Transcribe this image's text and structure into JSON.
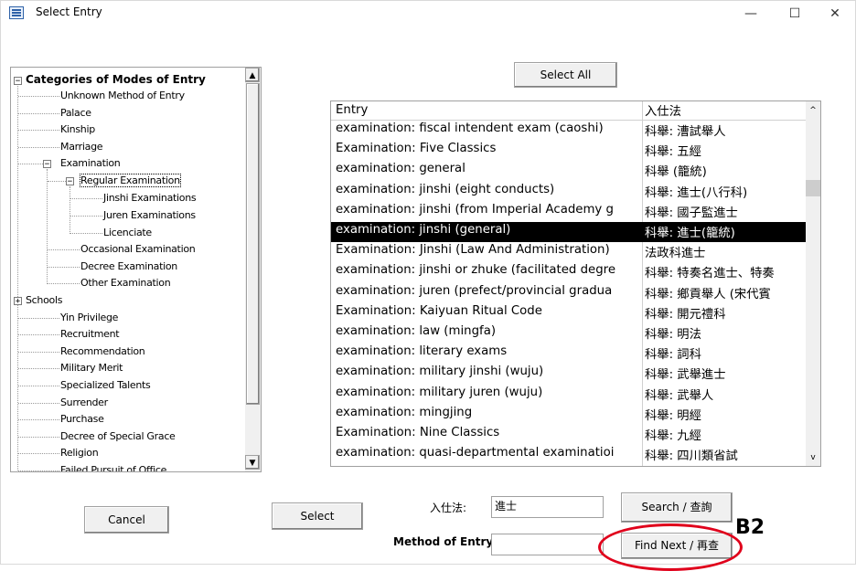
{
  "window": {
    "title": "Select Entry",
    "controls": {
      "minimize": "—",
      "maximize": "☐",
      "close": "✕"
    }
  },
  "tree": {
    "root": "Categories of Modes of Entry",
    "items": [
      "Unknown Method of Entry",
      "Palace",
      "Kinship",
      "Marriage",
      "Examination",
      "Regular Examination",
      "Jinshi Examinations",
      "Juren Examinations",
      "Licenciate",
      "Occasional Examination",
      "Decree Examination",
      "Other Examination",
      "Schools",
      "Yin Privilege",
      "Recruitment",
      "Recommendation",
      "Military Merit",
      "Specialized Talents",
      "Surrender",
      "Purchase",
      "Decree of Special Grace",
      "Religion",
      "Failed Pursuit of Office"
    ],
    "scroll_position": 0.0
  },
  "buttons": {
    "select_all": "Select All",
    "cancel": "Cancel",
    "select": "Select",
    "search": "Search / 查詢",
    "find_next": "Find Next / 再查"
  },
  "list": {
    "headers": [
      "Entry",
      "入仕法"
    ],
    "rows": [
      [
        "examination: fiscal intendent exam (caoshi)",
        "科舉: 漕試舉人"
      ],
      [
        "Examination: Five Classics",
        "科舉: 五經"
      ],
      [
        "examination: general",
        "科舉 (籠統)"
      ],
      [
        "examination: jinshi (eight conducts)",
        "科舉: 進士(八行科)"
      ],
      [
        "examination: jinshi (from Imperial Academy g",
        "科舉: 國子監進士"
      ],
      [
        "examination: jinshi (general)",
        "科舉: 進士(籠統)"
      ],
      [
        "Examination: Jinshi (Law And Administration)",
        "法政科進士"
      ],
      [
        "examination: jinshi or zhuke (facilitated degre",
        "科舉: 特奏名進士、特奏"
      ],
      [
        "examination: juren (prefect/provincial gradua",
        "科舉: 鄉貢舉人 (宋代賓"
      ],
      [
        "Examination: Kaiyuan Ritual Code",
        "科舉: 開元禮科"
      ],
      [
        "examination: law (mingfa)",
        "科舉: 明法"
      ],
      [
        "examination: literary exams",
        "科舉: 詞科"
      ],
      [
        "examination: military jinshi (wuju)",
        "科舉: 武舉進士"
      ],
      [
        "examination: military juren (wuju)",
        "科舉: 武舉人"
      ],
      [
        "examination: mingjing",
        "科舉: 明經"
      ],
      [
        "Examination: Nine Classics",
        "科舉: 九經"
      ],
      [
        "examination: quasi-departmental examinatioi",
        "科舉: 四川類省試"
      ]
    ],
    "selected_index": 5,
    "scroll_up": "^",
    "scroll_down": "v"
  },
  "form": {
    "ru_shi_fa_label": "入仕法:",
    "ru_shi_fa_value": "進士",
    "method_label": "Method of Entry:",
    "method_value": ""
  },
  "annotation": {
    "label": "B2",
    "color": "#e0001b"
  }
}
